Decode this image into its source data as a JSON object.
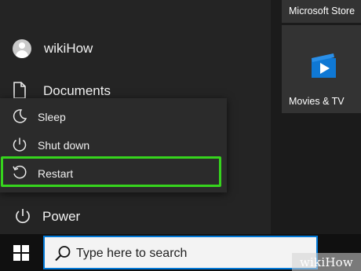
{
  "start_menu": {
    "user_name": "wikiHow",
    "documents_label": "Documents",
    "power_label": "Power",
    "power_menu": {
      "items": [
        {
          "label": "Sleep",
          "icon": "moon-icon"
        },
        {
          "label": "Shut down",
          "icon": "power-icon"
        },
        {
          "label": "Restart",
          "icon": "restart-icon"
        }
      ],
      "highlighted": "Restart",
      "highlight_color": "#36d41d"
    }
  },
  "tiles": [
    {
      "label": "Microsoft Store"
    },
    {
      "label": "Movies & TV",
      "icon": "movies-tv-icon"
    }
  ],
  "taskbar": {
    "start_icon": "windows-logo-icon",
    "search_placeholder": "Type here to search",
    "search_icon": "search-icon"
  },
  "watermark": {
    "text": "wikiHow"
  }
}
